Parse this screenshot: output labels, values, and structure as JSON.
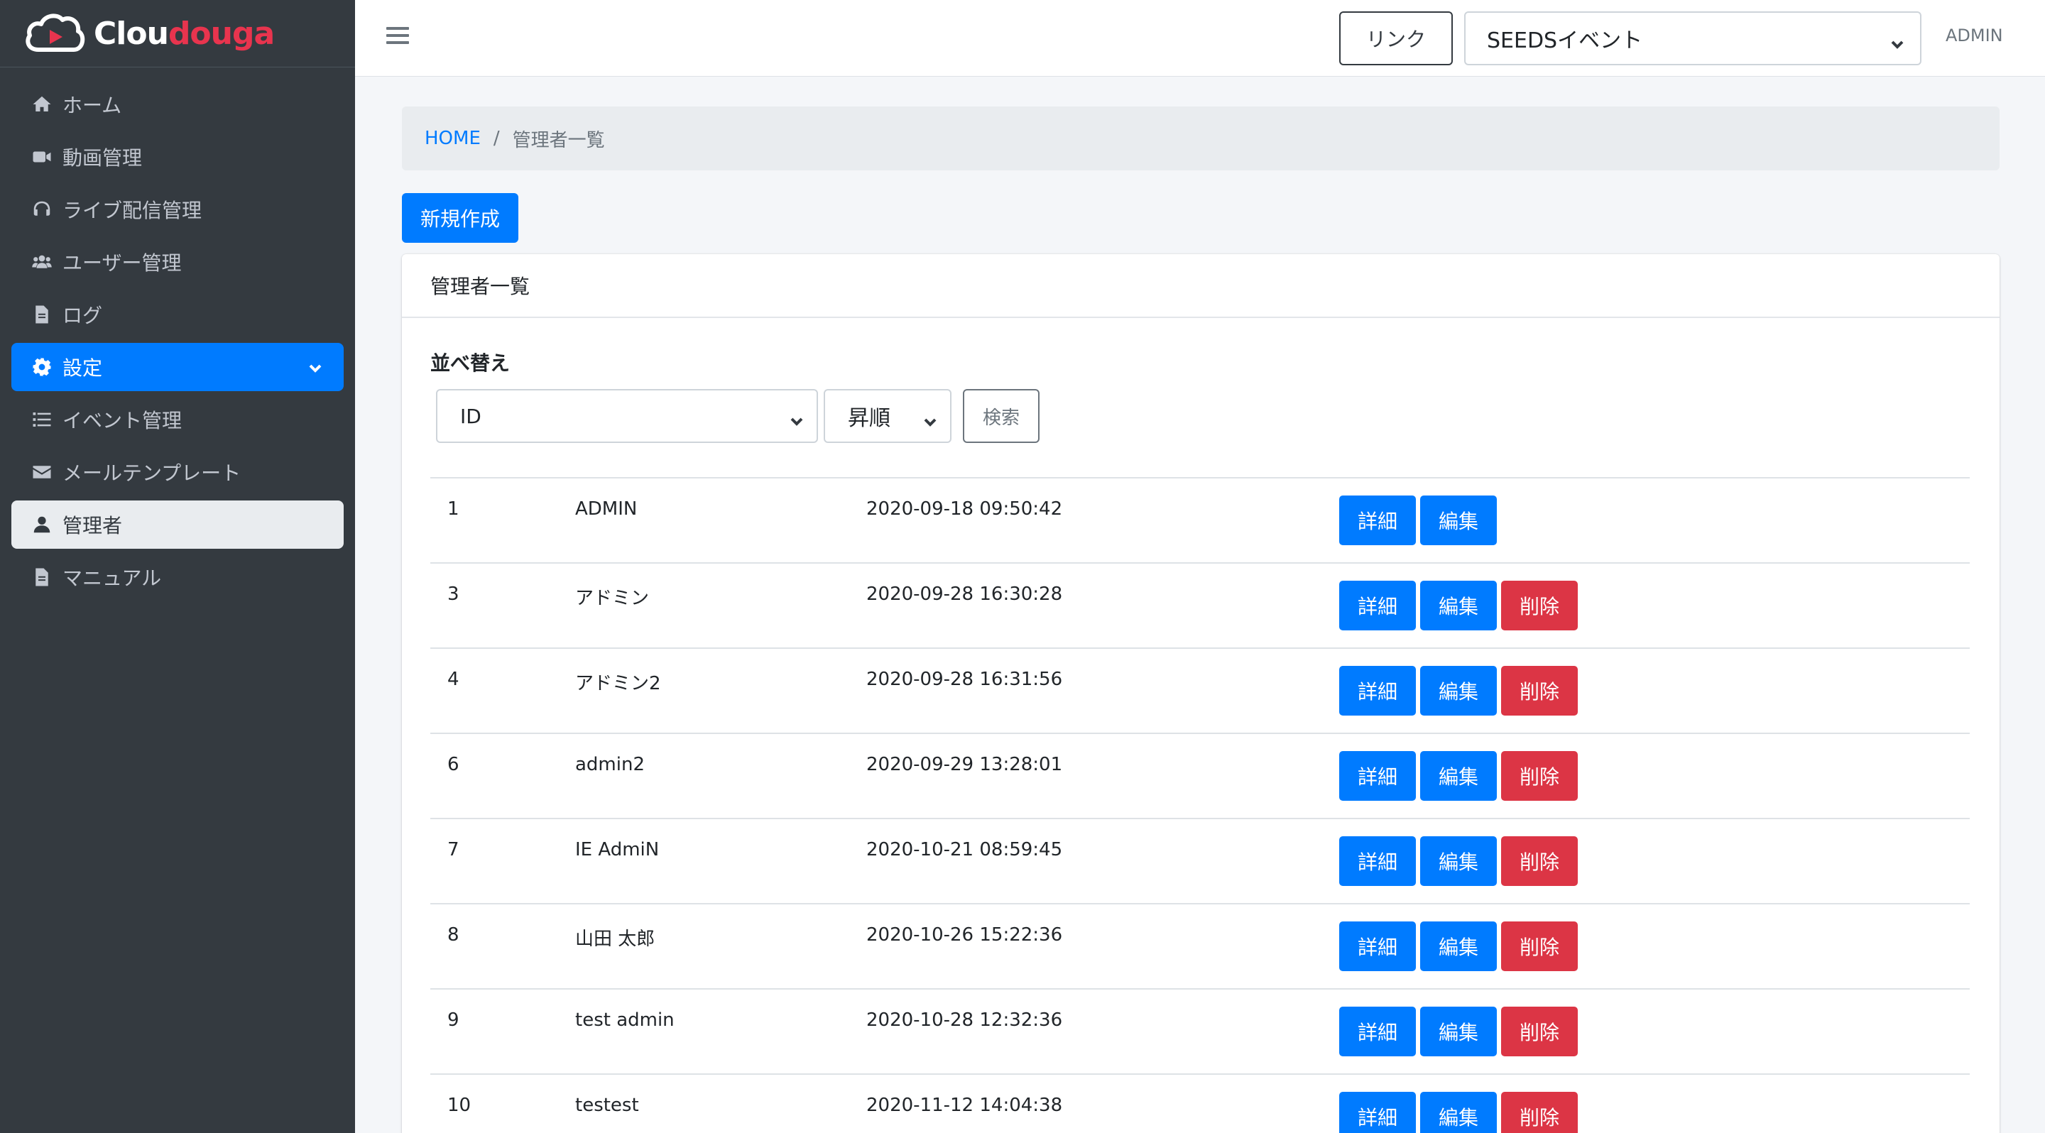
{
  "brand": {
    "name_prefix": "Clou",
    "name_suffix": "douga",
    "accent_color": "#e8344e"
  },
  "sidebar": {
    "items": [
      {
        "label": "ホーム",
        "icon": "home-icon",
        "state": "normal"
      },
      {
        "label": "動画管理",
        "icon": "video-icon",
        "state": "normal"
      },
      {
        "label": "ライブ配信管理",
        "icon": "headset-icon",
        "state": "normal"
      },
      {
        "label": "ユーザー管理",
        "icon": "users-icon",
        "state": "normal"
      },
      {
        "label": "ログ",
        "icon": "file-icon",
        "state": "normal"
      },
      {
        "label": "設定",
        "icon": "gear-icon",
        "state": "expanded"
      },
      {
        "label": "イベント管理",
        "icon": "list-icon",
        "state": "normal"
      },
      {
        "label": "メールテンプレート",
        "icon": "envelope-icon",
        "state": "normal"
      },
      {
        "label": "管理者",
        "icon": "user-icon",
        "state": "current"
      },
      {
        "label": "マニュアル",
        "icon": "file-icon",
        "state": "normal"
      }
    ]
  },
  "header": {
    "link_label": "リンク",
    "event_select_value": "SEEDSイベント",
    "user_label": "ADMIN"
  },
  "breadcrumb": {
    "home": "HOME",
    "separator": "/",
    "current": "管理者一覧"
  },
  "new_button_label": "新規作成",
  "card": {
    "title": "管理者一覧",
    "sort_label": "並べ替え",
    "sort_field_value": "ID",
    "sort_order_value": "昇順",
    "search_label": "検索"
  },
  "actions": {
    "detail": "詳細",
    "edit": "編集",
    "delete": "削除"
  },
  "rows": [
    {
      "id": "1",
      "name": "ADMIN",
      "date": "2020-09-18 09:50:42",
      "deletable": false
    },
    {
      "id": "3",
      "name": "アドミン",
      "date": "2020-09-28 16:30:28",
      "deletable": true
    },
    {
      "id": "4",
      "name": "アドミン2",
      "date": "2020-09-28 16:31:56",
      "deletable": true
    },
    {
      "id": "6",
      "name": "admin2",
      "date": "2020-09-29 13:28:01",
      "deletable": true
    },
    {
      "id": "7",
      "name": "IE AdmiN",
      "date": "2020-10-21 08:59:45",
      "deletable": true
    },
    {
      "id": "8",
      "name": "山田 太郎",
      "date": "2020-10-26 15:22:36",
      "deletable": true
    },
    {
      "id": "9",
      "name": "test admin",
      "date": "2020-10-28 12:32:36",
      "deletable": true
    },
    {
      "id": "10",
      "name": "testest",
      "date": "2020-11-12 14:04:38",
      "deletable": true
    }
  ],
  "colors": {
    "primary": "#007bff",
    "danger": "#dc3545",
    "sidebar_bg": "#343a40"
  }
}
